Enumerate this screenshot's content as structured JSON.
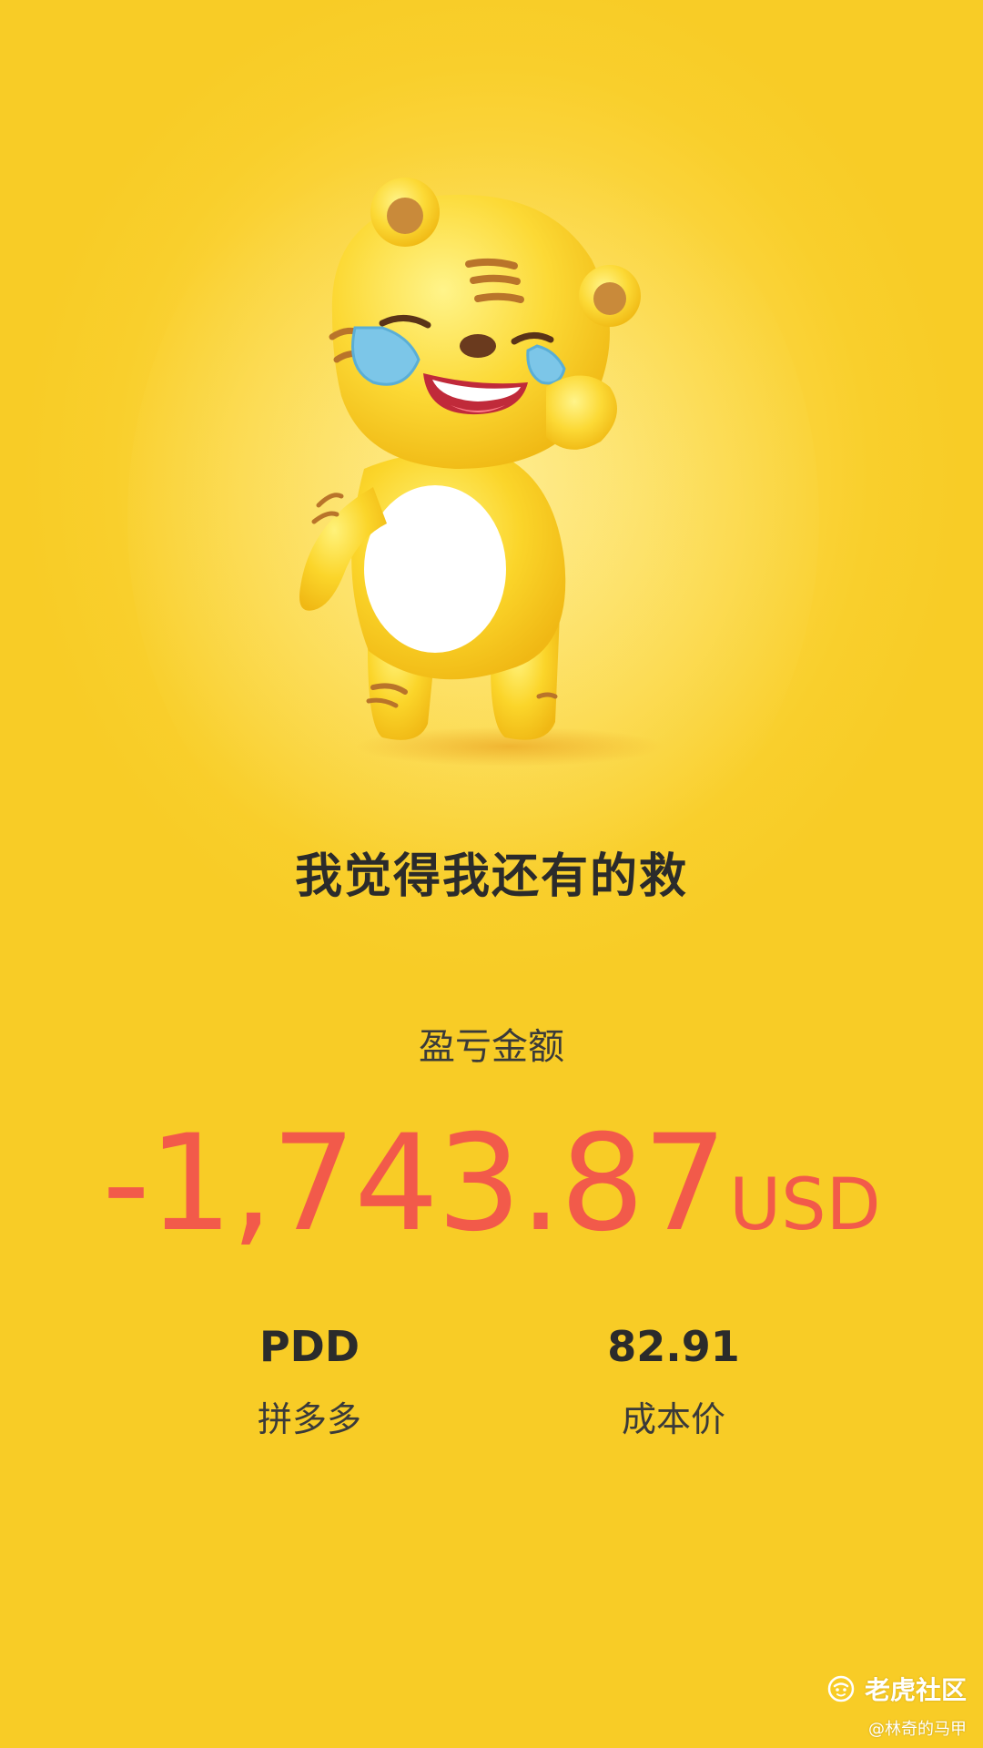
{
  "result": {
    "headline": "我觉得我还有的救",
    "pl_label": "盈亏金额",
    "pl_amount": "-1,743.87",
    "pl_currency": "USD",
    "pl_color": "#f25a4a"
  },
  "stock": {
    "symbol": "PDD",
    "name": "拼多多"
  },
  "cost": {
    "value": "82.91",
    "label": "成本价"
  },
  "mascot": {
    "icon": "crying-tiger-mascot-icon"
  },
  "watermark": {
    "logo_icon": "tiger-logo-icon",
    "brand": "老虎社区",
    "user": "@林奇的马甲"
  },
  "colors": {
    "background": "#f9cf2c",
    "text_dark": "#2b2b2b",
    "loss_red": "#f25a4a"
  }
}
